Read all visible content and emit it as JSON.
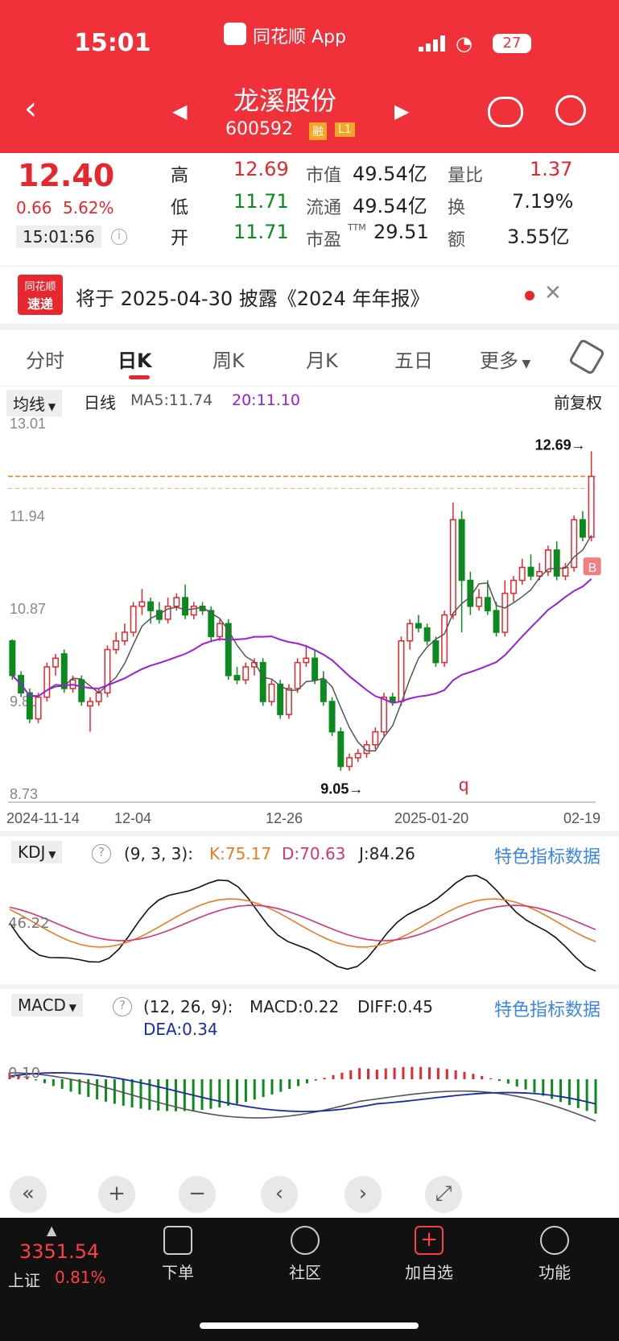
{
  "status_bar": {
    "time": "15:01",
    "app_name": "同花顺 App",
    "battery": "27"
  },
  "header": {
    "title": "龙溪股份",
    "code": "600592",
    "badge_rong": "融",
    "badge_level": "L1"
  },
  "quote": {
    "price": "12.40",
    "change": "0.66",
    "change_pct": "5.62%",
    "time": "15:01:56",
    "high_label": "高",
    "high": "12.69",
    "low_label": "低",
    "low": "11.71",
    "open_label": "开",
    "open": "11.71",
    "mktcap_label": "市值",
    "mktcap": "49.54亿",
    "float_label": "流通",
    "float_cap": "49.54亿",
    "pe_label": "市盈",
    "pe_sup": "TTM",
    "pe": "29.51",
    "vol_ratio_label": "量比",
    "vol_ratio": "1.37",
    "turnover_label": "换",
    "turnover": "7.19%",
    "amount_label": "额",
    "amount": "3.55亿"
  },
  "announcement": {
    "logo_top": "同花顺",
    "logo_bottom": "速递",
    "text": "将于 2025-04-30 披露《2024 年年报》"
  },
  "tabs": [
    {
      "label": "分时"
    },
    {
      "label": "日K"
    },
    {
      "label": "周K"
    },
    {
      "label": "月K"
    },
    {
      "label": "五日"
    },
    {
      "label": "更多"
    }
  ],
  "kline_bar": {
    "selector": "均线",
    "period": "日线",
    "ma5": "MA5:11.74",
    "ma20": "20:11.10",
    "adjust": "前复权"
  },
  "colors": {
    "up": "#e8262d",
    "down": "#0b8a1e",
    "ma5": "#555555",
    "ma20": "#9b1de0",
    "accent": "#f0313a",
    "link": "#3a86e6"
  },
  "chart_data": [
    {
      "type": "candlestick",
      "y_ticks": [
        "13.01",
        "11.94",
        "10.87",
        "9.80",
        "8.73"
      ],
      "ylim": [
        8.73,
        13.01
      ],
      "x_labels": [
        "2024-11-14",
        "12-04",
        "12-26",
        "2025-01-20",
        "02-19"
      ],
      "annotations": {
        "high": "12.69→",
        "low": "9.05→",
        "buy_marker": "B",
        "q_marker": "q"
      },
      "candles": [
        [
          10.5,
          10.1,
          10.52,
          10.05
        ],
        [
          10.1,
          9.9,
          10.15,
          9.85
        ],
        [
          9.9,
          9.6,
          9.95,
          9.55
        ],
        [
          9.6,
          9.85,
          9.9,
          9.55
        ],
        [
          9.85,
          10.2,
          10.25,
          9.8
        ],
        [
          10.2,
          10.3,
          10.35,
          10.1
        ],
        [
          10.35,
          9.95,
          10.4,
          9.9
        ],
        [
          9.95,
          10.05,
          10.1,
          9.9
        ],
        [
          10.05,
          9.8,
          10.1,
          9.75
        ],
        [
          9.75,
          9.8,
          9.85,
          9.45
        ],
        [
          9.8,
          9.9,
          9.95,
          9.75
        ],
        [
          9.9,
          10.4,
          10.45,
          9.85
        ],
        [
          10.4,
          10.5,
          10.6,
          10.35
        ],
        [
          10.5,
          10.6,
          10.7,
          10.45
        ],
        [
          10.6,
          10.9,
          10.95,
          10.55
        ],
        [
          10.9,
          10.95,
          11.1,
          10.8
        ],
        [
          10.95,
          10.85,
          11.0,
          10.7
        ],
        [
          10.85,
          10.75,
          10.95,
          10.7
        ],
        [
          10.75,
          10.9,
          11.0,
          10.7
        ],
        [
          10.9,
          11.0,
          11.05,
          10.85
        ],
        [
          11.0,
          10.8,
          11.15,
          10.75
        ],
        [
          10.8,
          10.9,
          10.95,
          10.75
        ],
        [
          10.9,
          10.85,
          10.95,
          10.8
        ],
        [
          10.85,
          10.55,
          10.9,
          10.5
        ],
        [
          10.55,
          10.7,
          10.75,
          10.5
        ],
        [
          10.7,
          10.1,
          10.75,
          10.05
        ],
        [
          10.1,
          10.05,
          10.2,
          10.0
        ],
        [
          10.05,
          10.2,
          10.25,
          10.0
        ],
        [
          10.2,
          10.25,
          10.3,
          10.1
        ],
        [
          10.25,
          9.8,
          10.3,
          9.75
        ],
        [
          9.8,
          10.0,
          10.05,
          9.75
        ],
        [
          10.0,
          9.65,
          10.05,
          9.6
        ],
        [
          9.65,
          9.95,
          10.0,
          9.6
        ],
        [
          9.95,
          10.25,
          10.3,
          9.9
        ],
        [
          10.25,
          10.3,
          10.45,
          10.2
        ],
        [
          10.3,
          10.05,
          10.4,
          10.0
        ],
        [
          10.05,
          9.8,
          10.15,
          9.75
        ],
        [
          9.8,
          9.45,
          9.85,
          9.4
        ],
        [
          9.45,
          9.05,
          9.5,
          9.0
        ],
        [
          9.05,
          9.15,
          9.2,
          9.0
        ],
        [
          9.15,
          9.2,
          9.25,
          9.1
        ],
        [
          9.2,
          9.3,
          9.35,
          9.15
        ],
        [
          9.3,
          9.45,
          9.5,
          9.25
        ],
        [
          9.45,
          9.85,
          9.9,
          9.4
        ],
        [
          9.85,
          9.8,
          9.9,
          9.75
        ],
        [
          9.8,
          10.5,
          10.55,
          9.75
        ],
        [
          10.5,
          10.7,
          10.75,
          10.4
        ],
        [
          10.7,
          10.65,
          10.8,
          10.6
        ],
        [
          10.65,
          10.5,
          10.7,
          10.45
        ],
        [
          10.5,
          10.25,
          10.55,
          10.2
        ],
        [
          10.25,
          10.8,
          10.85,
          10.2
        ],
        [
          10.8,
          11.9,
          12.1,
          10.75
        ],
        [
          11.9,
          11.2,
          12.0,
          10.6
        ],
        [
          11.2,
          10.9,
          11.3,
          10.8
        ],
        [
          10.9,
          11.0,
          11.1,
          10.85
        ],
        [
          11.0,
          10.85,
          11.2,
          10.8
        ],
        [
          10.85,
          10.6,
          10.95,
          10.55
        ],
        [
          10.6,
          11.05,
          11.2,
          10.55
        ],
        [
          11.05,
          11.2,
          11.25,
          10.95
        ],
        [
          11.2,
          11.35,
          11.45,
          11.15
        ],
        [
          11.35,
          11.25,
          11.5,
          11.2
        ],
        [
          11.25,
          11.3,
          11.4,
          11.2
        ],
        [
          11.3,
          11.55,
          11.6,
          11.25
        ],
        [
          11.55,
          11.25,
          11.65,
          11.2
        ],
        [
          11.25,
          11.35,
          11.4,
          11.2
        ],
        [
          11.35,
          11.9,
          11.95,
          11.3
        ],
        [
          11.9,
          11.7,
          12.0,
          11.65
        ],
        [
          11.7,
          12.4,
          12.69,
          11.65
        ]
      ]
    },
    {
      "type": "line",
      "title": "KDJ",
      "params": "(9, 3, 3):",
      "k": "K:75.17",
      "d": "D:70.63",
      "j": "J:84.26",
      "y_tick": "46.22",
      "link": "特色指标数据"
    },
    {
      "type": "bar",
      "title": "MACD",
      "params": "(12, 26, 9):",
      "macd": "MACD:0.22",
      "diff": "DIFF:0.45",
      "dea": "DEA:0.34",
      "y_tick": "0.10",
      "link": "特色指标数据"
    }
  ],
  "bottom_nav": {
    "index_value": "3351.54",
    "index_name": "上证",
    "index_pct": "0.81%",
    "items": [
      {
        "label": "下单"
      },
      {
        "label": "社区"
      },
      {
        "label": "加自选"
      },
      {
        "label": "功能"
      }
    ]
  }
}
